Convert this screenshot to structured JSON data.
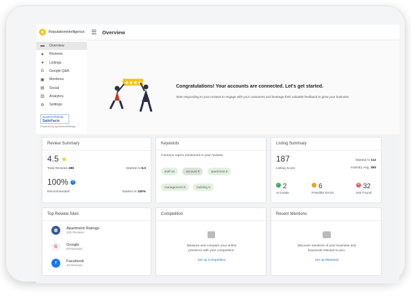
{
  "brand": {
    "name": "ReputationIntelligence"
  },
  "sidebar": {
    "items": [
      {
        "label": "Overview",
        "icon": "overview-icon",
        "glyph": "▬"
      },
      {
        "label": "Reviews",
        "icon": "star-icon",
        "glyph": "★"
      },
      {
        "label": "Listings",
        "icon": "location-icon",
        "glyph": "●"
      },
      {
        "label": "Google Q&A",
        "icon": "google-icon",
        "glyph": "G"
      },
      {
        "label": "Mentions",
        "icon": "mentions-icon",
        "glyph": "▣"
      },
      {
        "label": "Social",
        "icon": "social-icon",
        "glyph": "▤"
      },
      {
        "label": "Analytics",
        "icon": "analytics-icon",
        "glyph": "▥"
      },
      {
        "label": "Settings",
        "icon": "gear-icon",
        "glyph": "⚙"
      }
    ],
    "badge": {
      "top": "ApartmentRatings",
      "main": "SatisFacts"
    },
    "powered": "Powered by ApartmentRatings"
  },
  "header": {
    "title": "Overview"
  },
  "welcome": {
    "heading": "Congratulations! Your accounts are connected. Let's get started.",
    "text": "Start responding to your reviews to engage with your customers and leverage their valuable feedback to grow your business."
  },
  "review_summary": {
    "title": "Review Summary",
    "rating": "4.5",
    "total_label": "Total Reviews",
    "total": "289",
    "started_label": "Started At",
    "started_rating": "5.0",
    "recommended_pct": "100%",
    "recommended_label": "Recommended",
    "started_pct": "100%"
  },
  "keywords": {
    "title": "Keywords",
    "subtitle": "Common topics mentioned in your reviews",
    "chips": [
      "staff 16",
      "account 9",
      "apartment 8",
      "management 8",
      "building 6"
    ]
  },
  "listing_summary": {
    "title": "Listing Summary",
    "score": "187",
    "score_label": "Listing Score",
    "started_label": "Started At",
    "started": "112",
    "industry_label": "Industry Avg.",
    "industry": "350",
    "accurate": "2",
    "accurate_label": "Accurate",
    "errors": "6",
    "errors_label": "Possible Errors",
    "notfound": "32",
    "notfound_label": "Not Found",
    "colors": {
      "accurate": "#3aa655",
      "errors": "#f0a020",
      "notfound": "#e05a5a"
    }
  },
  "top_sites": {
    "title": "Top Review Sites",
    "sites": [
      {
        "name": "Apartment Ratings",
        "reviews": "203 Reviews",
        "icon": "apartment-ratings-icon",
        "color": "#3b5998",
        "glyph": "▦"
      },
      {
        "name": "Google",
        "reviews": "59 Reviews",
        "icon": "google-icon",
        "color": "#f1f1f1",
        "glyph": "G"
      },
      {
        "name": "Facebook",
        "reviews": "15 Reviews",
        "icon": "facebook-icon",
        "color": "#1877f2",
        "glyph": "f"
      }
    ]
  },
  "competition": {
    "title": "Competition",
    "text": "Measure and compare your online presence with your competition.",
    "link": "Set up Competition"
  },
  "mentions": {
    "title": "Recent Mentions",
    "text": "Discover mentions of your business and keywords relevant to you.",
    "link": "Set up Mentions"
  }
}
